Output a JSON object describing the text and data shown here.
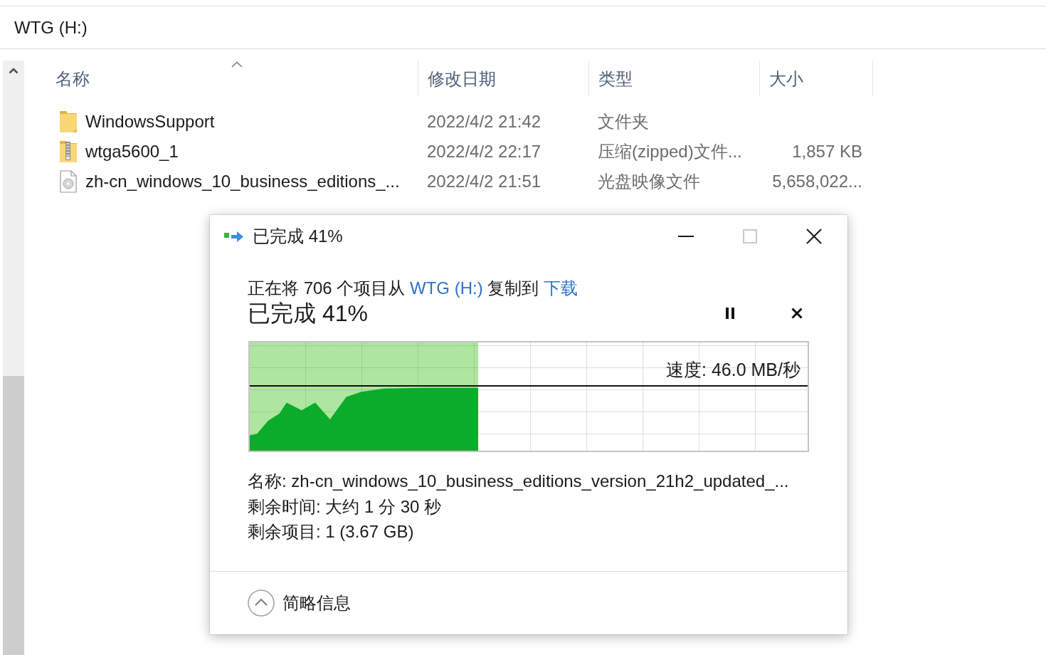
{
  "window": {
    "title": "WTG (H:)"
  },
  "file_list": {
    "columns": [
      {
        "label": "名称",
        "sorted": true
      },
      {
        "label": "修改日期",
        "sorted": false
      },
      {
        "label": "类型",
        "sorted": false
      },
      {
        "label": "大小",
        "sorted": false
      }
    ],
    "rows": [
      {
        "kind": "folder",
        "name": "WindowsSupport",
        "modified": "2022/4/2 21:42",
        "type": "文件夹"
      },
      {
        "kind": "zip",
        "name": "wtga5600_1",
        "modified": "2022/4/2 22:17",
        "type": "压缩(zipped)文件...",
        "size": "1,857 KB"
      },
      {
        "kind": "disc-image",
        "name": "zh-cn_windows_10_business_editions_...",
        "modified": "2022/4/2 21:51",
        "type": "光盘映像文件",
        "size": "5,658,022..."
      }
    ]
  },
  "copy_dialog": {
    "title": "已完成 41%",
    "window_controls": [
      {
        "kind": "minimize",
        "disabled": false
      },
      {
        "kind": "maximize",
        "disabled": true
      },
      {
        "kind": "close",
        "disabled": false
      }
    ],
    "description": [
      {
        "kind": "text",
        "text": "正在将 706 个项目从 "
      },
      {
        "kind": "link",
        "text": "WTG (H:)"
      },
      {
        "kind": "text",
        "text": " 复制到 "
      },
      {
        "kind": "link",
        "text": "下载"
      }
    ],
    "heading": "已完成 41%",
    "actions": [
      {
        "kind": "pause"
      },
      {
        "kind": "cancel"
      }
    ],
    "progress": {
      "level": 0.41,
      "speed": "速度: 46.0 MB/秒"
    },
    "details": [
      "名称: zh-cn_windows_10_business_editions_version_21h2_updated_...",
      "剩余时间: 大约 1 分 30 秒",
      "剩余项目: 1 (3.67 GB)"
    ],
    "details_toggle": {
      "label": "简略信息",
      "expanded": true
    }
  }
}
